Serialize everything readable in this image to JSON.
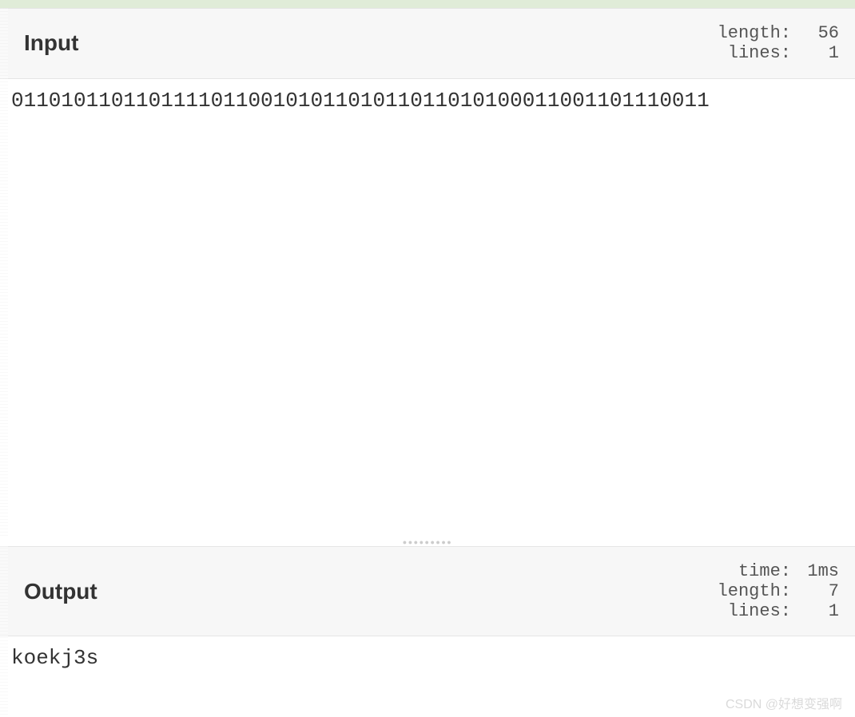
{
  "input": {
    "title": "Input",
    "stats": {
      "length_label": "length:",
      "length_value": "56",
      "lines_label": "lines:",
      "lines_value": "1"
    },
    "content": "01101011011011110110010101101011011010100011001101110011"
  },
  "output": {
    "title": "Output",
    "stats": {
      "time_label": "time:",
      "time_value": "1ms",
      "length_label": "length:",
      "length_value": "7",
      "lines_label": "lines:",
      "lines_value": "1"
    },
    "content": "koekj3s"
  },
  "watermark": "CSDN @好想变强啊"
}
